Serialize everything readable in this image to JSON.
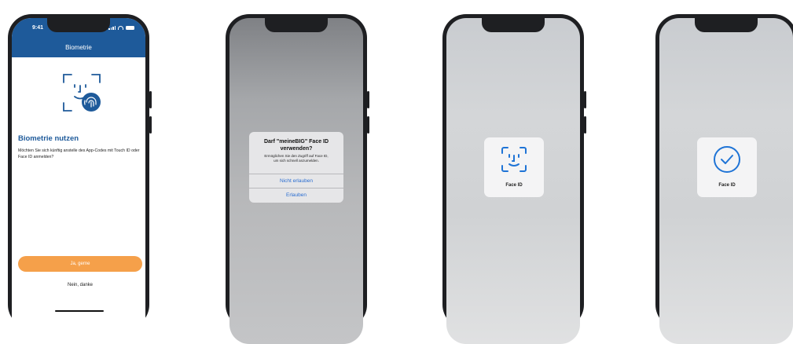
{
  "phone1": {
    "status_time": "9:41",
    "appbar_title": "Biometrie",
    "heading": "Biometrie nutzen",
    "description": "Möchten Sie sich künftig anstelle des App-Codes mit Touch ID oder Face ID anmelden?",
    "primary_button": "Ja, gerne",
    "secondary_button": "Nein, danke",
    "brand_color": "#1e5a9a",
    "accent_color": "#f5a04a",
    "icon": "face-fingerprint-icon"
  },
  "phone2": {
    "alert_title": "Darf \"meineBIG\" Face ID verwenden?",
    "alert_message": "Ermöglichen Sie den Zugriff auf Face ID, um sich schnell anzumelden.",
    "deny_button": "Nicht erlauben",
    "allow_button": "Erlauben"
  },
  "phone3": {
    "hud_label": "Face ID",
    "icon": "face-id-icon"
  },
  "phone4": {
    "hud_label": "Face ID",
    "icon": "checkmark-circle-icon"
  }
}
